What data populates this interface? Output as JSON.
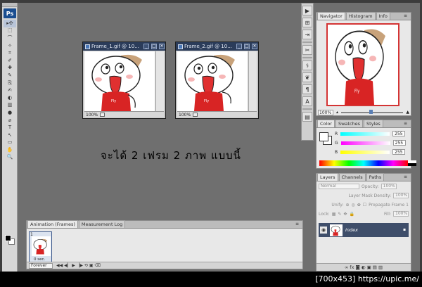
{
  "tools": {
    "logo": "Ps",
    "items": [
      "▸✣",
      "⬚",
      "⌒",
      "✧",
      "⌗",
      "✐",
      "✚",
      "✎",
      "⎘",
      "✍",
      "◐",
      "▥",
      "●",
      "⌀",
      "T",
      "↖",
      "▭",
      "✋",
      "🔍"
    ]
  },
  "documents": [
    {
      "title": "Frame_1.gif @ 10...",
      "zoom": "100%"
    },
    {
      "title": "Frame_2.gif @ 10...",
      "zoom": "100%"
    }
  ],
  "canvas_text": "จะได้ 2 เฟรม 2 ภาพ แบบนี้",
  "icon_strip": [
    "▶",
    "⊞",
    "⇥",
    "✂",
    "⚕",
    "❦",
    "¶",
    "A",
    "▤"
  ],
  "navigator": {
    "tabs": [
      "Navigator",
      "Histogram",
      "Info"
    ],
    "zoom": "100%"
  },
  "color": {
    "tabs": [
      "Color",
      "Swatches",
      "Styles"
    ],
    "rows": [
      {
        "label": "R",
        "value": "255"
      },
      {
        "label": "G",
        "value": "255"
      },
      {
        "label": "B",
        "value": "255"
      }
    ]
  },
  "layers": {
    "tabs": [
      "Layers",
      "Channels",
      "Paths"
    ],
    "blend_mode": "Normal",
    "opacity_label": "Opacity:",
    "opacity_value": "100%",
    "mask_density_label": "Layer Mask Density:",
    "mask_density_value": "100%",
    "unify_label": "Unify:",
    "propagate_label": "Propagate Frame 1",
    "lock_label": "Lock:",
    "fill_label": "Fill:",
    "fill_value": "100%",
    "layer_name": "Index",
    "footer_icons": "∞ fx ◙ ◐ ▣ ▤ ▥"
  },
  "animation": {
    "tabs": [
      "Animation (Frames)",
      "Measurement Log"
    ],
    "frame_number": "1",
    "frame_delay": "0 sec.",
    "loop": "Forever",
    "controls": "◀◀ ◀▏ ▶ ▕▶ ⟲ ▣ ⌫"
  },
  "watermark": "[700x453] https://upic.me/"
}
